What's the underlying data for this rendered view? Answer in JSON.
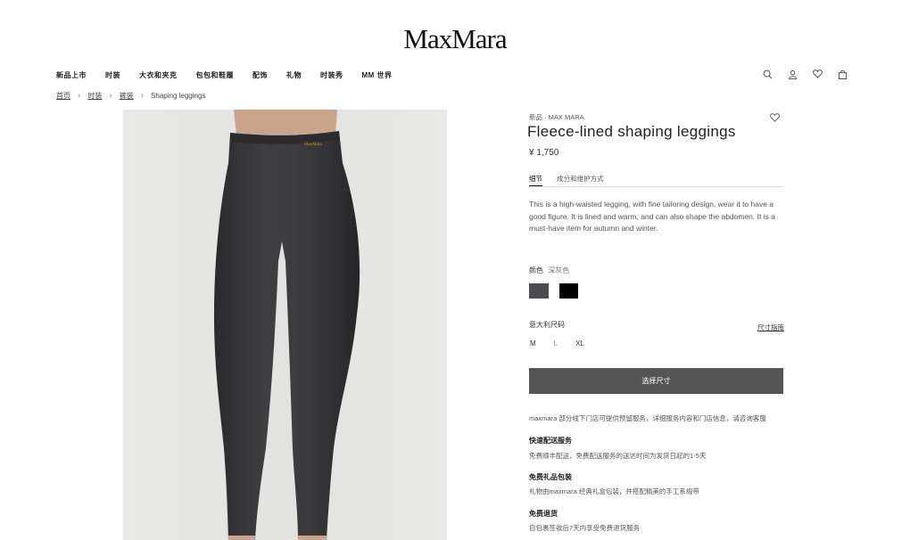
{
  "header": {
    "logo": "MaxMara",
    "nav": [
      "新品上市",
      "时装",
      "大衣和夹克",
      "包包和鞋履",
      "配饰",
      "礼物",
      "时装秀",
      "MM 世界"
    ],
    "icons": [
      "search-icon",
      "user-icon",
      "heart-icon",
      "bag-icon"
    ]
  },
  "breadcrumb": {
    "items": [
      "首页",
      "时装",
      "裤装"
    ],
    "current": "Shaping leggings"
  },
  "product": {
    "brand": "新品 · MAX MARA",
    "title": "Fleece-lined shaping leggings",
    "price": "¥ 1,750",
    "tabs": [
      "细节",
      "成分和维护方式"
    ],
    "description": "This is a high-waisted legging, with fine tailoring design, wear it to have a good figure. It is lined and warm, and can also shape the abdomen. It is a must-have item for autumn and winter.",
    "color_label": "颜色",
    "color_value": "深灰色",
    "colors": [
      "#4d4d50",
      "#000000"
    ],
    "size_label": "意大利尺码",
    "size_guide": "尺寸指南",
    "sizes": [
      "M",
      "L",
      "XL"
    ],
    "select_button": "选择尺寸",
    "store_note": "maxmara 部分线下门店可提供预留服务，详细服务内容和门店信息，请咨询客服",
    "sections": [
      {
        "heading": "快速配送服务",
        "text": "免费顺丰配送，免费配送服务的送达时间为发货日起的1-5天"
      },
      {
        "heading": "免费礼品包装",
        "text": "礼物由maxmara 经典礼盒包装，并搭配精美的手工系缎带"
      },
      {
        "heading": "免费退货",
        "text": "自包裹签收后7天内享受免费退货服务"
      }
    ]
  }
}
